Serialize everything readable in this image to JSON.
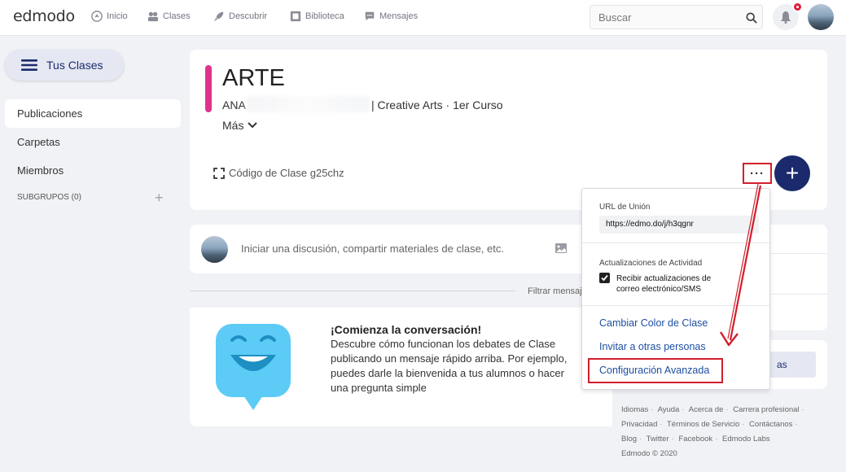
{
  "app": {
    "logo": "edmodo"
  },
  "nav": [
    {
      "label": "Inicio",
      "icon": "home-icon"
    },
    {
      "label": "Clases",
      "icon": "classes-icon"
    },
    {
      "label": "Descubrir",
      "icon": "rocket-icon"
    },
    {
      "label": "Biblioteca",
      "icon": "library-icon"
    },
    {
      "label": "Mensajes",
      "icon": "message-icon"
    }
  ],
  "search": {
    "placeholder": "Buscar"
  },
  "sidebar": {
    "toggle_label": "Tus Clases",
    "items": [
      {
        "label": "Publicaciones",
        "active": true
      },
      {
        "label": "Carpetas",
        "active": false
      },
      {
        "label": "Miembros",
        "active": false
      }
    ],
    "subgroups_label": "SUBGRUPOS (0)",
    "subgroups_add": "+"
  },
  "class": {
    "title": "ARTE",
    "teacher": "ANA",
    "meta": "| Creative Arts  · 1er Curso",
    "more_label": "Más",
    "code_label": "Código de Clase g25chz",
    "accent_color": "#e0338c"
  },
  "composer": {
    "placeholder": "Iniciar una discusión, compartir materiales de clase, etc."
  },
  "filter": {
    "label": "Filtrar mensaje"
  },
  "empty_state": {
    "title": "¡Comienza la conversación!",
    "body": "Descubre cómo funcionan los debates de Clase publicando un mensaje rápido arriba. Por ejemplo, puedes darle la bienvenida a tus alumnos o hacer una pregunta simple"
  },
  "right_panel": {
    "button_fragment": "as"
  },
  "dropdown": {
    "url_label": "URL de Unión",
    "url_value": "https://edmo.do/j/h3qgnr",
    "activity_label": "Actualizaciones de Actividad",
    "checkbox_label": "Recibir actualizaciones de correo electrónico/SMS",
    "checkbox_checked": true,
    "links": [
      "Cambiar Color de Clase",
      "Invitar a otras personas",
      "Configuración Avanzada"
    ]
  },
  "footer": {
    "links": [
      "Idiomas",
      "Ayuda",
      "Acerca de",
      "Carrera profesional",
      "Privacidad",
      "Términos de Servicio",
      "Contáctanos",
      "Blog",
      "Twitter",
      "Facebook",
      "Edmodo Labs"
    ],
    "copyright": "Edmodo © 2020"
  },
  "colors": {
    "brand_navy": "#1a2a6c",
    "link_blue": "#1d4fa3",
    "annotation_red": "#d21f2c",
    "mascot_blue": "#5ccbf5"
  }
}
